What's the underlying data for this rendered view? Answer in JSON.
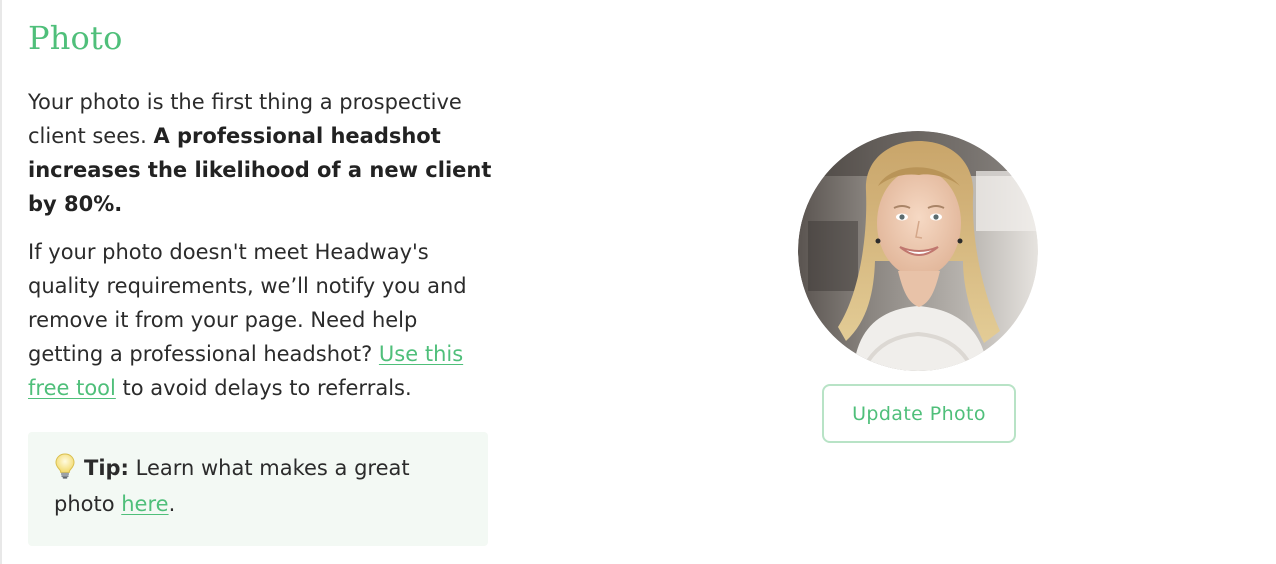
{
  "section": {
    "title": "Photo"
  },
  "intro": {
    "text": "Your photo is the first thing a prospective client sees. ",
    "bold": "A professional headshot increases the likelihood of a new client by 80%."
  },
  "requirements": {
    "text_before_link": "If your photo doesn't meet Headway's quality requirements, we’ll notify you and remove it from your page. Need help getting a professional headshot? ",
    "link_label": "Use this free tool",
    "text_after_link": " to avoid delays to referrals."
  },
  "tip": {
    "icon": "light-bulb-icon",
    "label": "Tip:",
    "text": " Learn what makes a great photo ",
    "link_label": "here",
    "trailing": "."
  },
  "photo": {
    "update_button_label": "Update Photo"
  },
  "colors": {
    "accent": "#4fbf7a",
    "tip_background": "#f3f9f4",
    "button_border": "#b8e3c6"
  }
}
